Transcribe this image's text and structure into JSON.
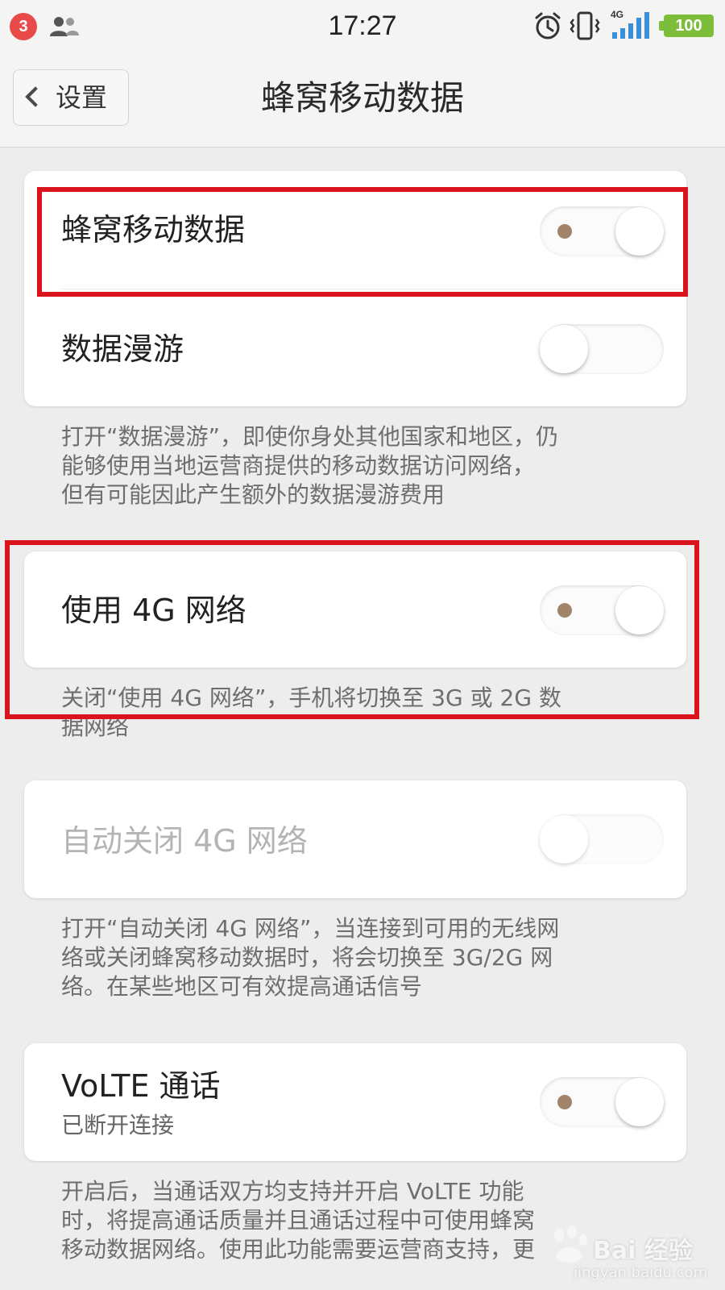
{
  "status_bar": {
    "notification_count": "3",
    "time": "17:27",
    "network_type": "4G",
    "battery": "100",
    "icons": [
      "contacts-icon",
      "alarm-icon",
      "vibrate-icon",
      "signal-icon",
      "battery-icon"
    ]
  },
  "nav": {
    "back_label": "设置",
    "title": "蜂窝移动数据"
  },
  "settings": {
    "cellular_data": {
      "label": "蜂窝移动数据",
      "enabled": true
    },
    "data_roaming": {
      "label": "数据漫游",
      "enabled": false,
      "description": [
        "打开“数据漫游”，即使你身处其他国家和地区，仍",
        "能够使用当地运营商提供的移动数据访问网络，",
        "但有可能因此产生额外的数据漫游费用"
      ]
    },
    "use_4g": {
      "label": "使用 4G 网络",
      "enabled": true,
      "description": [
        "关闭“使用 4G 网络”，手机将切换至 3G 或 2G 数",
        "据网络"
      ]
    },
    "auto_close_4g": {
      "label": "自动关闭 4G 网络",
      "enabled": false,
      "disabled": true,
      "description": [
        "打开“自动关闭 4G 网络”，当连接到可用的无线网",
        "络或关闭蜂窝移动数据时，将会切换至 3G/2G 网",
        "络。在某些地区可有效提高通话信号"
      ]
    },
    "volte": {
      "label": "VoLTE 通话",
      "status": "已断开连接",
      "enabled": true,
      "description": [
        "开启后，当通话双方均支持并开启 VoLTE 功能",
        "时，将提高通话质量并且通话过程中可使用蜂窝",
        "移动数据网络。使用此功能需要运营商支持，更"
      ]
    }
  },
  "watermark": {
    "text": "Bai 经验",
    "url": "jingyan.baidu.com"
  },
  "colors": {
    "highlight": "#d9141c",
    "toggle_dot": "#a0856a",
    "battery": "#7cbd3a",
    "badge": "#e84a4a"
  }
}
